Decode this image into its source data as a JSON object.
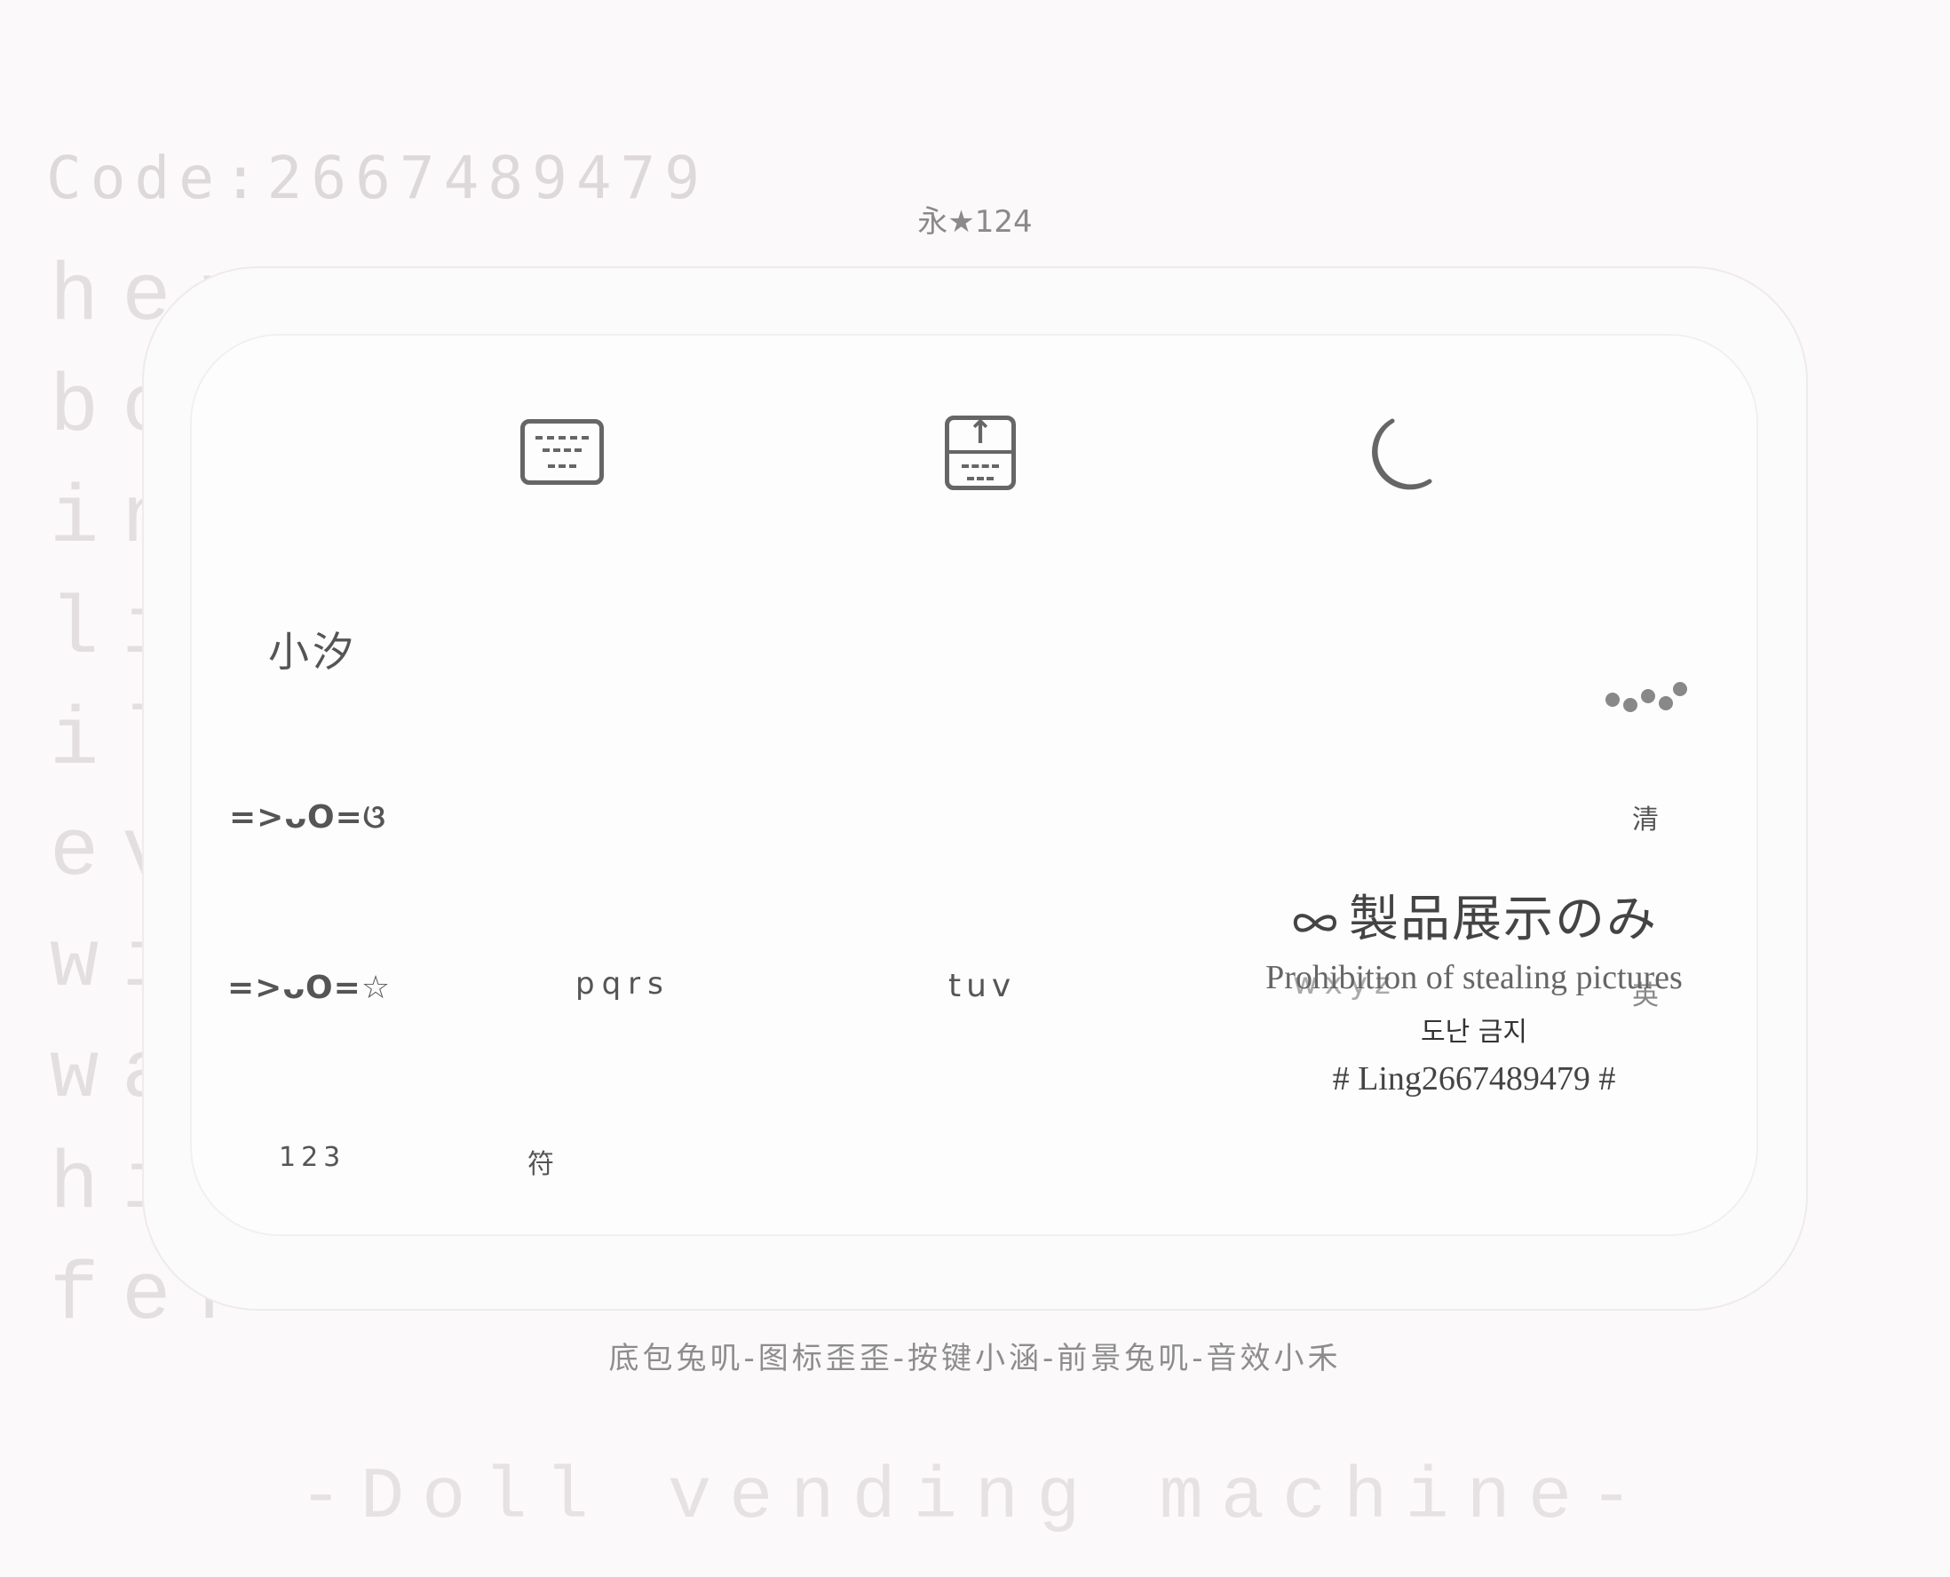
{
  "background": {
    "code": "Code:2667489479",
    "lines": [
      "her",
      "bo",
      "in",
      "li",
      "il",
      "ev",
      "wi",
      "wa",
      "hi",
      "fer"
    ],
    "footer": "-Doll vending machine-"
  },
  "header": {
    "label": "永★124"
  },
  "toolbar": {
    "keyboard_icon": "keyboard-icon",
    "upload_icon": "keyboard-upload-icon",
    "moon_icon": "moon-icon"
  },
  "keys": {
    "name": "小汐",
    "emoticon_1": "=>ᴗO=ଓ",
    "emoticon_2": "=>ᴗO=☆",
    "pqrs": "pqrs",
    "tuv": "tuv",
    "wxyz": "wxyz",
    "clear": "清",
    "english": "英",
    "numbers": "123",
    "symbols": "符"
  },
  "watermark": {
    "title": "製品展示のみ",
    "subtitle": "Prohibition of stealing pictures",
    "korean": "도난 금지",
    "hashtag": "# Ling2667489479 #"
  },
  "credits": "底包兔叽-图标歪歪-按键小涵-前景兔叽-音效小禾",
  "colors": {
    "icon": "#666666",
    "text": "#555555",
    "panel": "#fefdfd"
  }
}
